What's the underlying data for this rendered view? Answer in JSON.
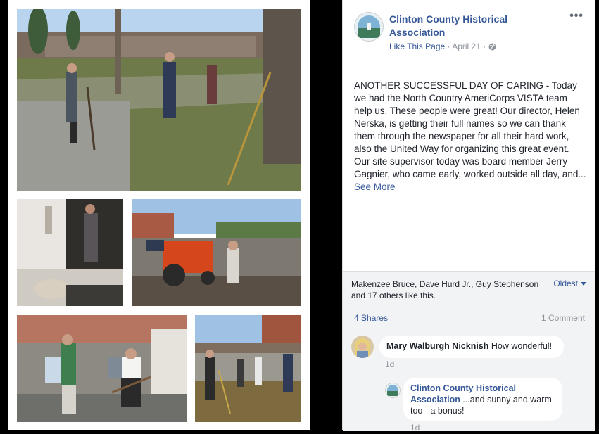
{
  "post": {
    "page_name": "Clinton County Historical Association",
    "like_page": "Like This Page",
    "date": "April 21",
    "more_icon": "more-icon",
    "audience_icon": "globe-icon",
    "text_p1": "ANOTHER SUCCESSFUL DAY OF CARING - Today we had the North Country AmeriCorps VISTA team help us. These people were great! Our director, Helen Nerska, is getting their full names so we can thank them through the newspaper for all their hard work, also the United Way for organizing this great event.",
    "text_p2": "Our site supervisor today was board member Jerry Gagnier, who came early, worked outside all day, and...",
    "see_more": "See More"
  },
  "reactions": {
    "likes_text": "Makenzee Bruce, Dave Hurd Jr., Guy Stephenson and 17 others like this.",
    "order": "Oldest",
    "shares": "4 Shares",
    "comments_count": "1 Comment"
  },
  "comments": [
    {
      "author": "Mary Walburgh Nicknish",
      "text": "How wonderful!",
      "time": "1d"
    },
    {
      "author": "Clinton County Historical Association",
      "text": "...and sunny and warm too - a bonus!",
      "time": "1d"
    }
  ],
  "colors": {
    "link": "#365899",
    "panel_bg": "#ffffff",
    "reactions_bg": "#f2f3f5"
  }
}
